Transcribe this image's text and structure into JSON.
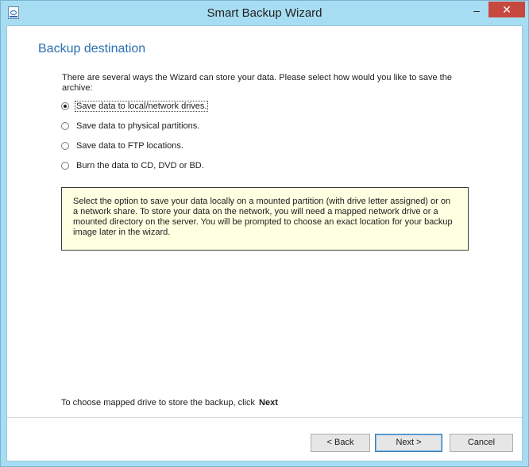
{
  "window": {
    "title": "Smart Backup Wizard",
    "minimize_glyph": "–",
    "close_glyph": "✕"
  },
  "page": {
    "heading": "Backup destination",
    "intro": "There are several ways the Wizard can store your data. Please select how would you like to save the archive:",
    "options": [
      {
        "label": "Save data to local/network drives.",
        "selected": true
      },
      {
        "label": "Save data to physical partitions.",
        "selected": false
      },
      {
        "label": "Save data to FTP locations.",
        "selected": false
      },
      {
        "label": "Burn the data to CD, DVD or BD.",
        "selected": false
      }
    ],
    "info": "Select the option to save your data locally on a mounted partition (with drive letter assigned) or on a network share. To store your data on the network, you will need a mapped network drive or a mounted directory on the server. You will be prompted to choose an exact location for your backup image later in the wizard.",
    "hint_text": "To choose mapped drive to store the backup, click",
    "hint_action": "Next"
  },
  "buttons": {
    "back": "< Back",
    "next": "Next >",
    "cancel": "Cancel"
  },
  "colors": {
    "frame": "#a7ddf2",
    "heading": "#2b6fb4",
    "info_background": "#ffffe1",
    "close_button": "#c7483e"
  }
}
